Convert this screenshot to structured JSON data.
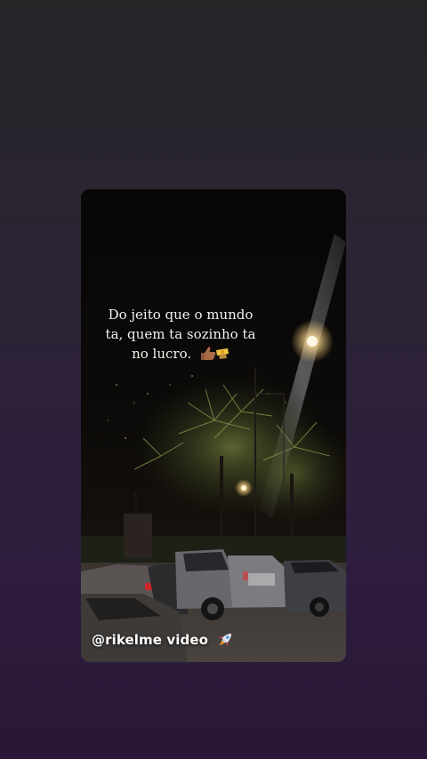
{
  "story": {
    "caption_line1": "Do jeito que o mundo",
    "caption_line2": "ta, quem ta sozinho ta",
    "caption_line3": "no lucro.",
    "caption_emoji": "thumbs-up-and-money-icon",
    "watermark": "@rikelme video",
    "watermark_icon": "rocket-icon"
  },
  "colors": {
    "background_top": "#262528",
    "background_bottom": "#2a1636",
    "card_background": "#0b0908",
    "caption_text": "#f4f1ee",
    "watermark_text": "#ffffff"
  }
}
